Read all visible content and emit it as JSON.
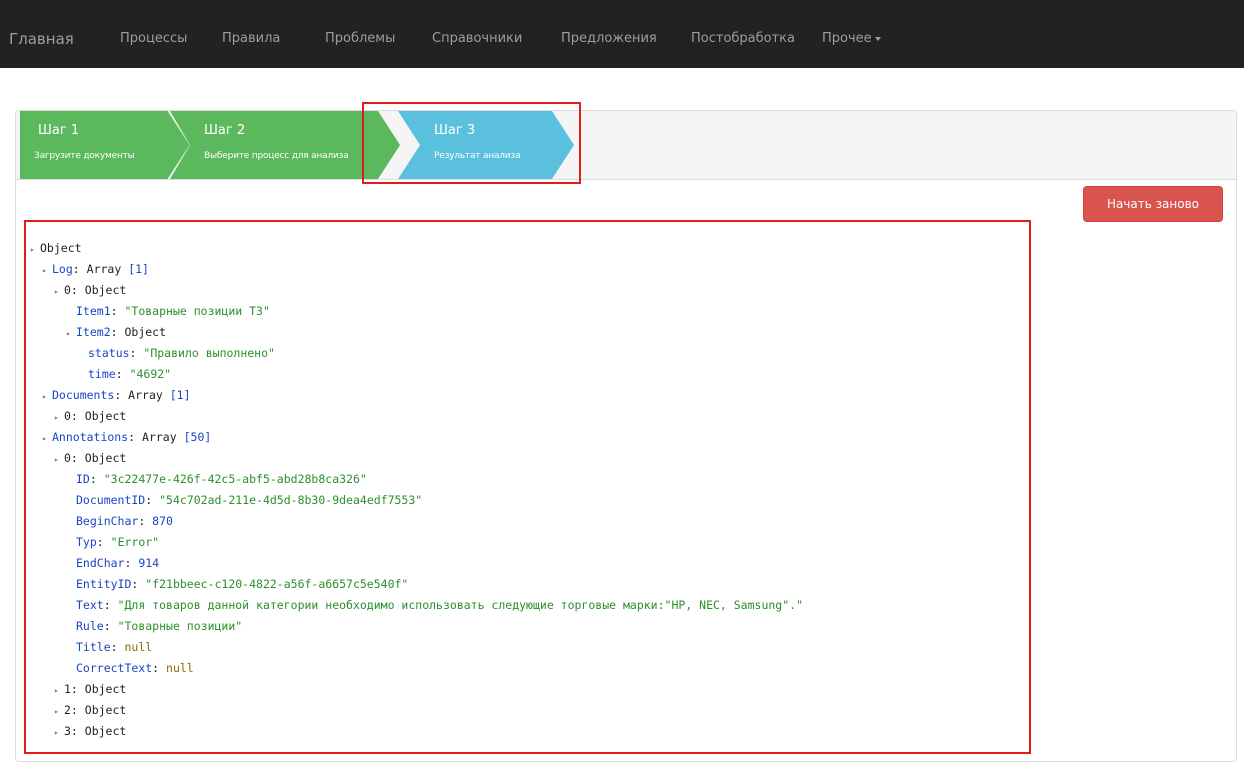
{
  "nav": {
    "brand": "Главная",
    "items": [
      "Процессы",
      "Правила",
      "Проблемы",
      "Справочники",
      "Предложения",
      "Постобработка",
      "Прочее"
    ]
  },
  "wizard": {
    "steps": [
      {
        "title": "Шаг 1",
        "subtitle": "Загрузите документы",
        "state": "done",
        "color": "#5cb85c"
      },
      {
        "title": "Шаг 2",
        "subtitle": "Выберите процесс для анализа",
        "state": "done",
        "color": "#5cb85c"
      },
      {
        "title": "Шаг 3",
        "subtitle": "Результат анализа",
        "state": "active",
        "color": "#5bc0de"
      }
    ]
  },
  "restart_label": "Начать заново",
  "tree": {
    "root": "Object",
    "log_key": "Log",
    "log_type": "Array",
    "log_count": "[1]",
    "log0": "0: Object",
    "item1_key": "Item1",
    "item1_val": "\"Товарные позиции ТЗ\"",
    "item2_key": "Item2",
    "item2_val": "Object",
    "status_key": "status",
    "status_val": "\"Правило выполнено\"",
    "time_key": "time",
    "time_val": "\"4692\"",
    "docs_key": "Documents",
    "docs_type": "Array",
    "docs_count": "[1]",
    "docs0": "0: Object",
    "ann_key": "Annotations",
    "ann_type": "Array",
    "ann_count": "[50]",
    "ann0": "0: Object",
    "id_key": "ID",
    "id_val": "\"3c22477e-426f-42c5-abf5-abd28b8ca326\"",
    "docid_key": "DocumentID",
    "docid_val": "\"54c702ad-211e-4d5d-8b30-9dea4edf7553\"",
    "begin_key": "BeginChar",
    "begin_val": "870",
    "typ_key": "Typ",
    "typ_val": "\"Error\"",
    "end_key": "EndChar",
    "end_val": "914",
    "entity_key": "EntityID",
    "entity_val": "\"f21bbeec-c120-4822-a56f-a6657c5e540f\"",
    "text_key": "Text",
    "text_val": "\"Для товаров данной категории необходимо использовать следующие торговые марки:\"HP, NEC, Samsung\".\"",
    "rule_key": "Rule",
    "rule_val": "\"Товарные позиции\"",
    "title_key": "Title",
    "title_val": "null",
    "correct_key": "CorrectText",
    "correct_val": "null",
    "ann1": "1: Object",
    "ann2": "2: Object",
    "ann3": "3: Object"
  },
  "colors": {
    "navbar": "#222222",
    "step_done": "#5cb85c",
    "step_active": "#5bc0de",
    "restart_button": "#d9534f",
    "annotation_box": "#e31b1b"
  }
}
